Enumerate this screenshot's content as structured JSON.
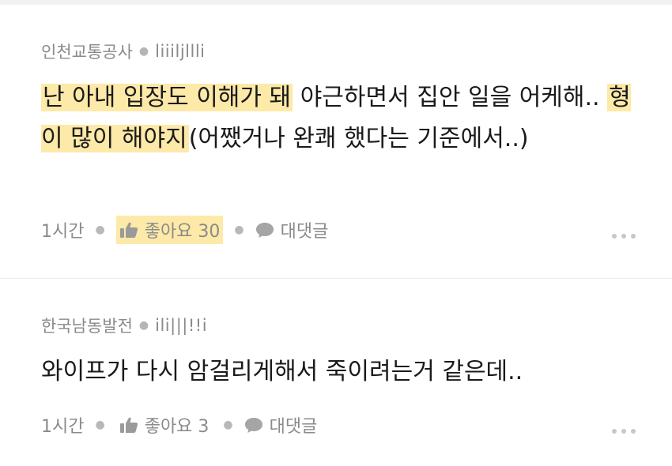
{
  "comments": [
    {
      "author": "인천교통공사",
      "nickname": "liiiljllli",
      "body_parts": [
        {
          "text": "난 아내 입장도 이해가 돼",
          "highlight": true
        },
        {
          "text": " 야근하면서 집안 일을 어케해.. ",
          "highlight": false
        },
        {
          "text": "형이 많이 해야지",
          "highlight": true
        },
        {
          "text": "(어쨌거나 완쾌 했다는 기준에서..)",
          "highlight": false
        }
      ],
      "time": "1시간",
      "like_label": "좋아요 30",
      "like_highlight": true,
      "reply_label": "대댓글"
    },
    {
      "author": "한국남동발전",
      "nickname": "ili|||!!i",
      "body_parts": [
        {
          "text": "와이프가 다시 암걸리게해서 죽이려는거 같은데..",
          "highlight": false
        }
      ],
      "time": "1시간",
      "like_label": "좋아요 3",
      "like_highlight": false,
      "reply_label": "대댓글"
    }
  ],
  "icons": {
    "like": "thumbs-up-icon",
    "reply": "speech-bubble-icon",
    "more": "more-dots-icon"
  },
  "colors": {
    "highlight": "#fde9a8",
    "meta_text": "#8a8a8a",
    "body_text": "#1a1a1a"
  }
}
